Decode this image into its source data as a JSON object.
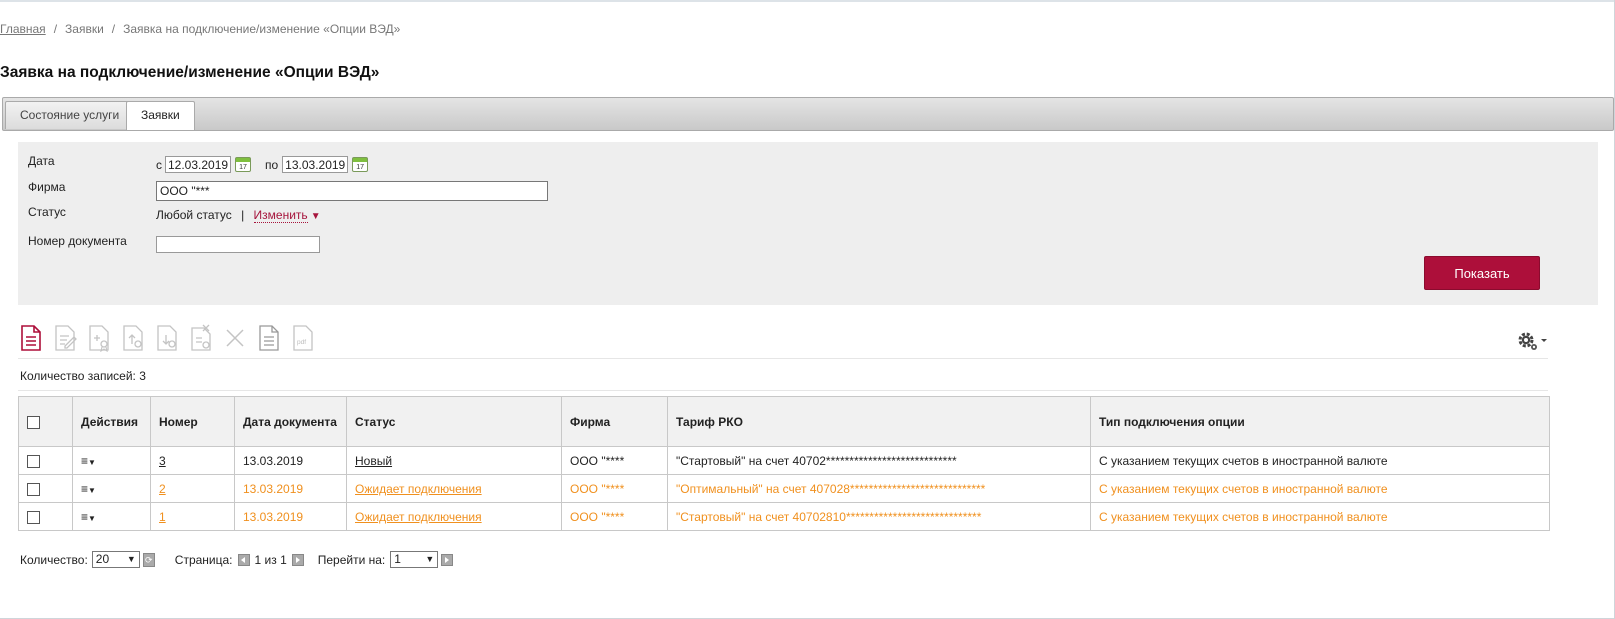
{
  "breadcrumb": {
    "home": "Главная",
    "requests": "Заявки",
    "current": "Заявка на подключение/изменение «Опции ВЭД»"
  },
  "page": {
    "title": "Заявка на подключение/изменение «Опции ВЭД»"
  },
  "tabs": [
    {
      "label": "Состояние услуги",
      "active": false
    },
    {
      "label": "Заявки",
      "active": true
    }
  ],
  "filter": {
    "date_label": "Дата",
    "from_label": "с",
    "date_from": "12.03.2019",
    "to_label": "по",
    "date_to": "13.03.2019",
    "calendar_day": "17",
    "firm_label": "Фирма",
    "firm_value": "ООО \"***",
    "status_label": "Статус",
    "status_value": "Любой статус",
    "status_sep": "|",
    "status_change": "Изменить",
    "docnum_label": "Номер документа",
    "docnum_value": "",
    "show_button": "Показать"
  },
  "toolbar": {
    "icons": [
      "new-document-icon",
      "edit-document-icon",
      "sign-document-icon",
      "upload-document-icon",
      "download-document-icon",
      "remove-signature-icon",
      "delete-icon",
      "copy-document-icon",
      "pdf-icon",
      "settings-gear-icon"
    ],
    "pdf_text": "pdf"
  },
  "records": {
    "count_text": "Количество записей: 3"
  },
  "table": {
    "headers": {
      "actions": "Действия",
      "number": "Номер",
      "doc_date": "Дата документа",
      "status": "Статус",
      "firm": "Фирма",
      "tariff": "Тариф РКО",
      "option_type": "Тип подключения опции"
    },
    "rows": [
      {
        "number": "3",
        "date": "13.03.2019",
        "status": "Новый",
        "firm": "ООО \"****",
        "tariff": "\"Стартовый\" на счет 40702****************************",
        "option_type": "С указанием текущих счетов в иностранной валюте"
      },
      {
        "number": "2",
        "date": "13.03.2019",
        "status": "Ожидает подключения",
        "firm": "ООО \"****",
        "tariff": "\"Оптимальный\" на счет 407028*****************************",
        "option_type": "С указанием текущих счетов в иностранной валюте"
      },
      {
        "number": "1",
        "date": "13.03.2019",
        "status": "Ожидает подключения",
        "firm": "ООО \"****",
        "tariff": "\"Стартовый\" на счет 40702810*****************************",
        "option_type": "С указанием текущих счетов в иностранной валюте"
      }
    ]
  },
  "pager": {
    "count_label": "Количество:",
    "count_value": "20",
    "page_label": "Страница:",
    "page_value": "1 из 1",
    "goto_label": "Перейти на:",
    "goto_value": "1"
  },
  "colors": {
    "accent": "#ad0f3a",
    "pending": "#f0901e"
  }
}
